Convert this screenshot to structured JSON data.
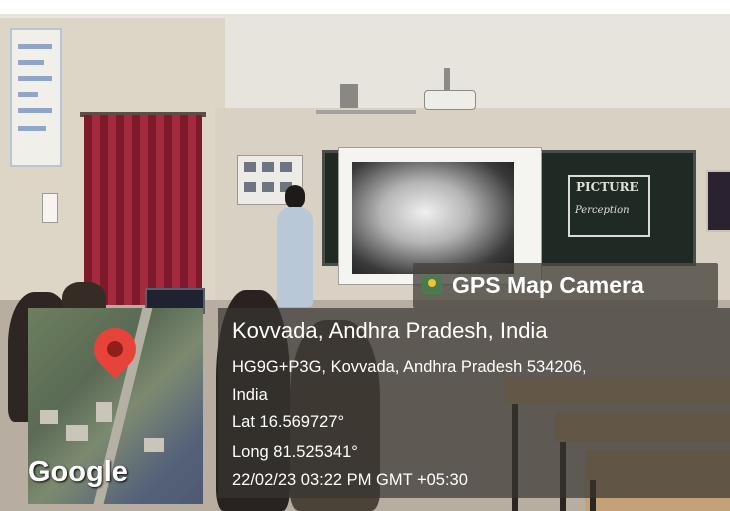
{
  "overlay": {
    "app_title": "GPS Map Camera",
    "place": "Kovvada, Andhra Pradesh, India",
    "address_line": "HG9G+P3G, Kovvada, Andhra Pradesh 534206,",
    "country": "India",
    "latitude": "Lat 16.569727°",
    "longitude": "Long 81.525341°",
    "timestamp": "22/02/23 03:22 PM GMT +05:30",
    "map_watermark": "Google",
    "colors": {
      "pin": "#e8433a",
      "overlay_text": "#ffffff"
    }
  },
  "scene": {
    "board_word": "PICTURE",
    "board_subword": "Perception"
  },
  "icons": [
    "gps-app-icon",
    "map-pin-icon"
  ]
}
